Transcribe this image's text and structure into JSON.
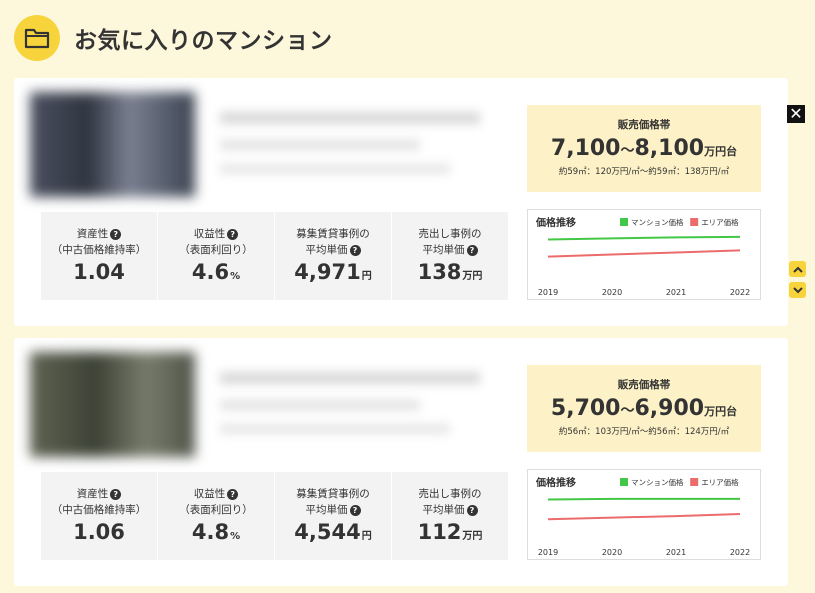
{
  "header": {
    "title": "お気に入りのマンション",
    "icon": "folder-icon"
  },
  "controls": {
    "close_label": "✕"
  },
  "metric_labels": {
    "asset": [
      "資産性",
      "（中古価格維持率）"
    ],
    "yield": [
      "収益性",
      "（表面利回り）"
    ],
    "rent": [
      "募集賃貸事例の",
      "平均単価"
    ],
    "sale": [
      "売出し事例の",
      "平均単価"
    ]
  },
  "units": {
    "percent": "%",
    "yen": "円",
    "man_yen": "万円",
    "man_yen_dai": "万円台",
    "tilde": "〜"
  },
  "properties": [
    {
      "metrics": {
        "asset": "1.04",
        "yield": "4.6",
        "rent": "4,971",
        "sale": "138"
      },
      "price": {
        "header": "販売価格帯",
        "low": "7,100",
        "high": "8,100",
        "sub": "約59㎡：120万円/㎡〜約59㎡：138万円/㎡"
      }
    },
    {
      "metrics": {
        "asset": "1.06",
        "yield": "4.8",
        "rent": "4,544",
        "sale": "112"
      },
      "price": {
        "header": "販売価格帯",
        "low": "5,700",
        "high": "6,900",
        "sub": "約56㎡：103万円/㎡〜約56㎡：124万円/㎡"
      }
    }
  ],
  "chart_data": [
    {
      "type": "line",
      "title": "価格推移",
      "x": [
        "2019",
        "2020",
        "2021",
        "2022"
      ],
      "legend_position": "top-right",
      "series": [
        {
          "name": "マンション価格",
          "color": "#44c744",
          "values": [
            0.78,
            0.8,
            0.82,
            0.83
          ]
        },
        {
          "name": "エリア価格",
          "color": "#ec6b6b",
          "values": [
            0.45,
            0.49,
            0.53,
            0.57
          ]
        }
      ],
      "ylim": [
        0,
        1
      ],
      "grid": false
    },
    {
      "type": "line",
      "title": "価格推移",
      "x": [
        "2019",
        "2020",
        "2021",
        "2022"
      ],
      "legend_position": "top-right",
      "series": [
        {
          "name": "マンション価格",
          "color": "#44c744",
          "values": [
            0.78,
            0.79,
            0.79,
            0.79
          ]
        },
        {
          "name": "エリア価格",
          "color": "#ec6b6b",
          "values": [
            0.4,
            0.43,
            0.46,
            0.5
          ]
        }
      ],
      "ylim": [
        0,
        1
      ],
      "grid": false
    }
  ],
  "colors": {
    "accent": "#f7d43c",
    "background": "#fdf7dc",
    "price_bg": "#fdf2c7",
    "metric_bg": "#f3f3f3"
  }
}
